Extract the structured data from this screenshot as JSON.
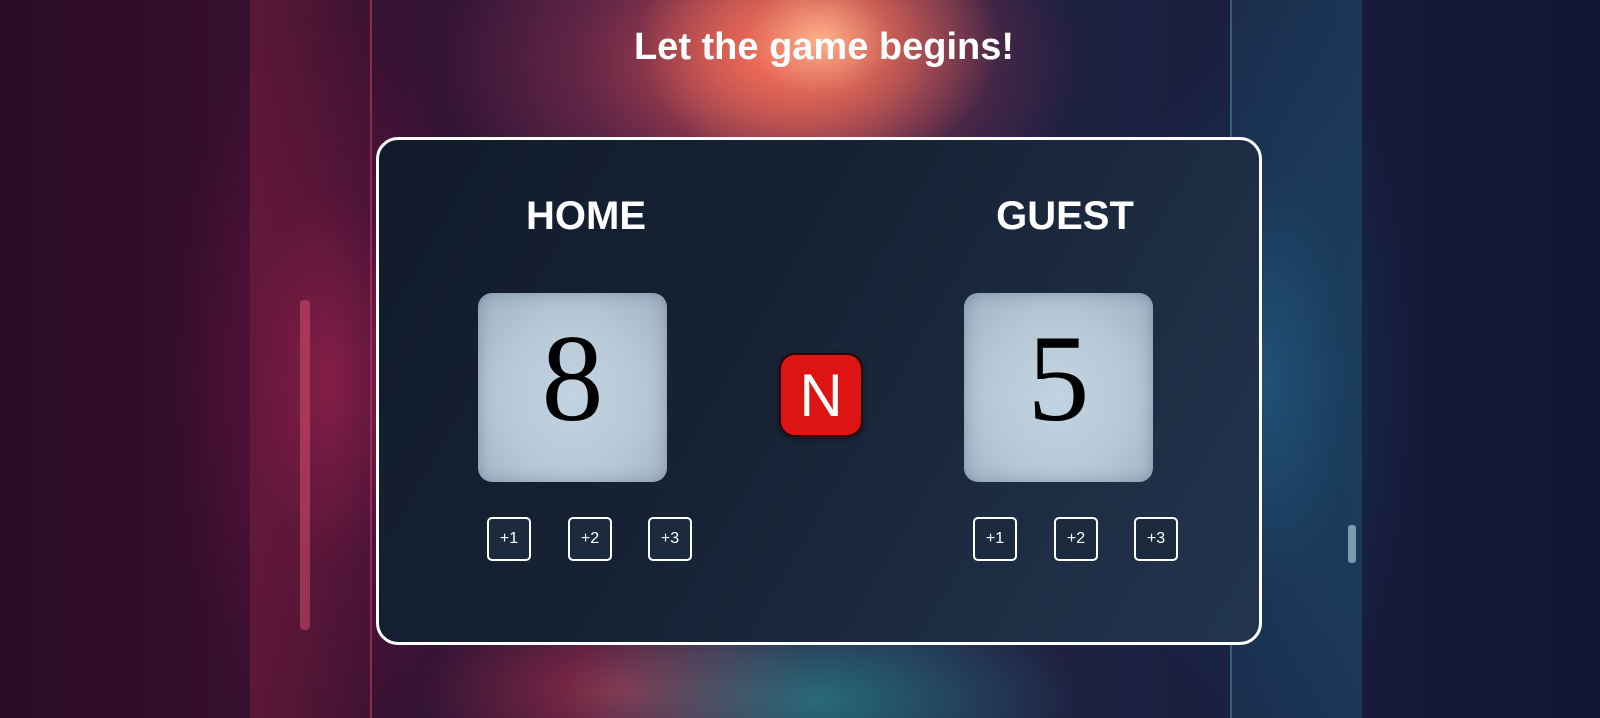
{
  "page": {
    "title": "Let the game begins!"
  },
  "scoreboard": {
    "home": {
      "label": "HOME",
      "score": "8",
      "buttons": [
        "+1",
        "+2",
        "+3"
      ]
    },
    "guest": {
      "label": "GUEST",
      "score": "5",
      "buttons": [
        "+1",
        "+2",
        "+3"
      ]
    },
    "center_button": {
      "label": "N",
      "color": "#dd1414"
    }
  },
  "colors": {
    "panel_border": "#ffffff",
    "score_box": "#b6c7d6",
    "text": "#ffffff"
  }
}
